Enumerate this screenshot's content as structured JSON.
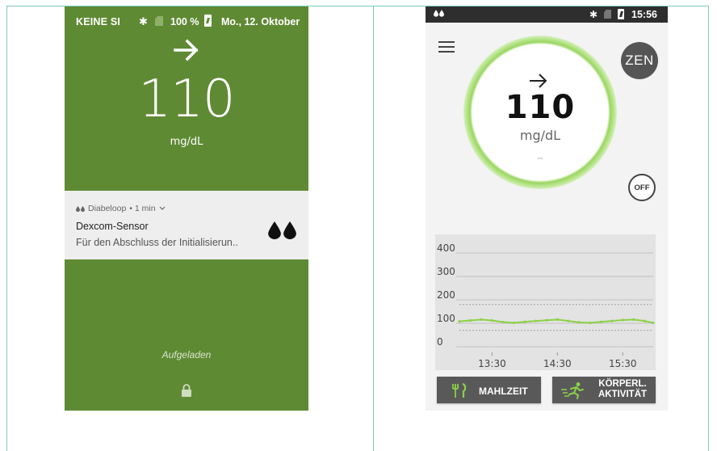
{
  "lock_screen": {
    "status_bar": {
      "carrier": "KEINE SI",
      "battery": "100 %",
      "date": "Mo., 12. Oktober",
      "icons": [
        "bluetooth-icon",
        "no-sim-icon",
        "battery-charging-icon"
      ]
    },
    "trend_arrow": "arrow-right-icon",
    "glucose_value": "110",
    "glucose_unit": "mg/dL",
    "notification": {
      "app": "Diabeloop",
      "time": "• 1 min",
      "title": "Dexcom-Sensor",
      "body": "Für den Abschluss der Initialisierun.."
    },
    "charging_text": "Aufgeladen",
    "background_color": "#5f8a34"
  },
  "app_screen": {
    "status_bar": {
      "time": "15:56",
      "icons": [
        "drops-icon",
        "bluetooth-icon",
        "no-sim-icon",
        "battery-charging-icon"
      ]
    },
    "zen_label": "ZEN",
    "off_label": "OFF",
    "gauge": {
      "trend_arrow": "arrow-right-icon",
      "value": "110",
      "unit": "mg/dL",
      "sub": "--",
      "ring_color": "#9ad65f"
    },
    "buttons": {
      "meal": "MAHLZEIT",
      "activity_line1": "KÖRPERL.",
      "activity_line2": "AKTIVITÄT"
    },
    "accent_color": "#8cd147",
    "chart_data": {
      "type": "line",
      "yticks": [
        "400",
        "300",
        "200",
        "100",
        "0"
      ],
      "ylim": [
        0,
        400
      ],
      "xticks": [
        "13:30",
        "14:30",
        "15:30"
      ],
      "xtick_minutes": [
        30,
        90,
        150
      ],
      "xlim_minutes": [
        0,
        178
      ],
      "target_range": [
        70,
        180
      ],
      "x_minutes": [
        0,
        10,
        20,
        30,
        40,
        50,
        60,
        70,
        80,
        90,
        100,
        110,
        120,
        130,
        140,
        150,
        160,
        170,
        178
      ],
      "values": [
        108,
        112,
        116,
        112,
        105,
        102,
        106,
        110,
        113,
        116,
        110,
        104,
        102,
        106,
        110,
        114,
        116,
        110,
        102
      ],
      "grid": true
    }
  }
}
